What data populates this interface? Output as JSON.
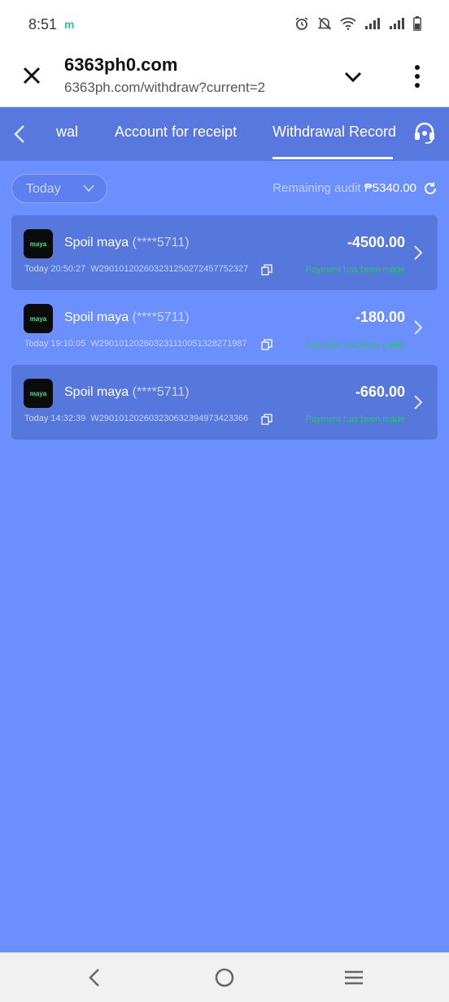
{
  "status_bar": {
    "time": "8:51",
    "app_indicator": "m",
    "icons": [
      "alarm-icon",
      "mute-icon",
      "wifi-icon",
      "signal-icon",
      "signal-icon",
      "battery-icon"
    ]
  },
  "browser": {
    "title": "6363ph0.com",
    "url": "6363ph.com/withdraw?current=2"
  },
  "tabs": [
    {
      "label": "wal"
    },
    {
      "label": "Account for receipt"
    },
    {
      "label": "Withdrawal Record",
      "active": true
    }
  ],
  "filter": {
    "selected": "Today"
  },
  "audit": {
    "label": "Remaining audit",
    "amount": "₱5340.00"
  },
  "records": [
    {
      "logo_text": "maya",
      "name": "Spoil maya",
      "account": "(****5711)",
      "amount": "-4500.00",
      "time": "Today 20:50:27",
      "order_id": "W290101202603231250272457752327",
      "status": "Payment has been made"
    },
    {
      "logo_text": "maya",
      "name": "Spoil maya",
      "account": "(****5711)",
      "amount": "-180.00",
      "time": "Today 19:10:05",
      "order_id": "W290101202603231110051328271987",
      "status": "Payment has been made"
    },
    {
      "logo_text": "maya",
      "name": "Spoil maya",
      "account": "(****5711)",
      "amount": "-660.00",
      "time": "Today 14:32:39",
      "order_id": "W290101202603230632394973423366",
      "status": "Payment has been made"
    }
  ],
  "colors": {
    "page_bg": "#6b8ffc",
    "tab_bar": "#5878e0",
    "record_dark": "#5677dc",
    "status_green": "#29c46a"
  }
}
